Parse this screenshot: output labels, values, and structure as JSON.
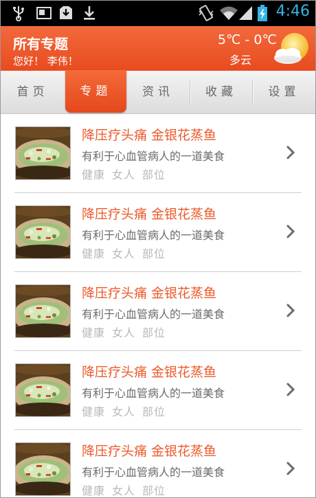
{
  "status_bar": {
    "time": "4:46",
    "icons": [
      "usb-icon",
      "screenshot-icon",
      "download-box-icon",
      "download-icon",
      "vibrate-icon",
      "wifi-icon",
      "signal-icon",
      "battery-charging-icon"
    ]
  },
  "header": {
    "title": "所有专题",
    "greeting": "您好！ 李伟！",
    "temperature": "5℃ - 0℃",
    "weather": "多云",
    "weather_icon": "partly-cloudy-icon"
  },
  "tabs": [
    {
      "label": "首页",
      "active": false
    },
    {
      "label": "专题",
      "active": true
    },
    {
      "label": "资讯",
      "active": false
    },
    {
      "label": "收藏",
      "active": false
    },
    {
      "label": "设置",
      "active": false
    }
  ],
  "items": [
    {
      "title": "降压疗头痛 金银花蒸鱼",
      "subtitle": "有利于心血管病人的一道美食",
      "tags": [
        "健康",
        "女人",
        "部位"
      ]
    },
    {
      "title": "降压疗头痛 金银花蒸鱼",
      "subtitle": "有利于心血管病人的一道美食",
      "tags": [
        "健康",
        "女人",
        "部位"
      ]
    },
    {
      "title": "降压疗头痛 金银花蒸鱼",
      "subtitle": "有利于心血管病人的一道美食",
      "tags": [
        "健康",
        "女人",
        "部位"
      ]
    },
    {
      "title": "降压疗头痛 金银花蒸鱼",
      "subtitle": "有利于心血管病人的一道美食",
      "tags": [
        "健康",
        "女人",
        "部位"
      ]
    },
    {
      "title": "降压疗头痛 金银花蒸鱼",
      "subtitle": "有利于心血管病人的一道美食",
      "tags": [
        "健康",
        "女人",
        "部位"
      ]
    }
  ],
  "colors": {
    "accent": "#ec5a2b",
    "header": "#e84b1f",
    "status_time": "#33b5e5"
  }
}
